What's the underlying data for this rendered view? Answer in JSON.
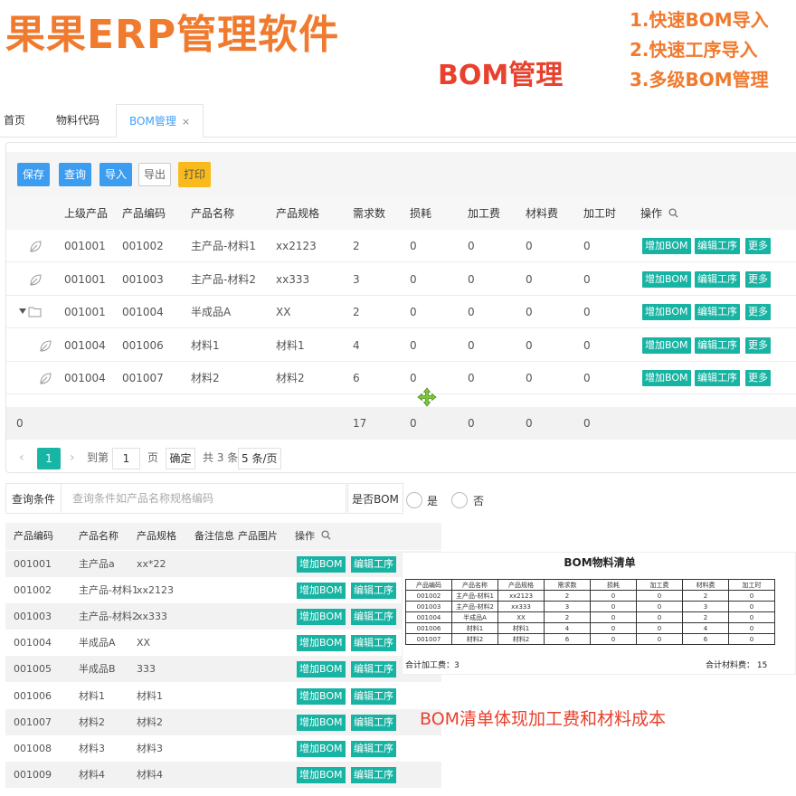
{
  "promo": {
    "title": "果果ERP管理软件",
    "subtitle": "BOM管理",
    "features": [
      "1.快速BOM导入",
      "2.快速工序导入",
      "3.多级BOM管理"
    ],
    "note": "BOM清单体现加工费和材料成本"
  },
  "tabs": [
    {
      "label": "首页"
    },
    {
      "label": "物料代码"
    },
    {
      "label": "BOM管理",
      "close": "×"
    }
  ],
  "toolbar": {
    "save": "保存",
    "query": "查询",
    "import": "导入",
    "export": "导出",
    "print": "打印"
  },
  "bom_table": {
    "headers": [
      "上级产品",
      "产品编码",
      "产品名称",
      "产品规格",
      "需求数",
      "损耗",
      "加工费",
      "材料费",
      "加工时",
      "操作"
    ],
    "rows": [
      {
        "parent": "001001",
        "code": "001002",
        "name": "主产品-材料1",
        "spec": "xx2123",
        "qty": "2",
        "loss": "0",
        "proc_fee": "0",
        "mat_fee": "0",
        "hours": "0",
        "icon": "leaf"
      },
      {
        "parent": "001001",
        "code": "001003",
        "name": "主产品-材料2",
        "spec": "xx333",
        "qty": "3",
        "loss": "0",
        "proc_fee": "0",
        "mat_fee": "0",
        "hours": "0",
        "icon": "leaf"
      },
      {
        "parent": "001001",
        "code": "001004",
        "name": "半成品A",
        "spec": "XX",
        "qty": "2",
        "loss": "0",
        "proc_fee": "0",
        "mat_fee": "0",
        "hours": "0",
        "icon": "folder"
      },
      {
        "parent": "001004",
        "code": "001006",
        "name": "材料1",
        "spec": "材料1",
        "qty": "4",
        "loss": "0",
        "proc_fee": "0",
        "mat_fee": "0",
        "hours": "0",
        "icon": "leaf"
      },
      {
        "parent": "001004",
        "code": "001007",
        "name": "材料2",
        "spec": "材料2",
        "qty": "6",
        "loss": "0",
        "proc_fee": "0",
        "mat_fee": "0",
        "hours": "0",
        "icon": "leaf"
      }
    ],
    "actions": [
      "增加BOM",
      "编辑工序",
      "更多"
    ],
    "footer": {
      "first": "0",
      "qty": "17",
      "loss": "0",
      "proc_fee": "0",
      "mat_fee": "0",
      "hours": "0"
    }
  },
  "pager": {
    "current": "1",
    "goto": "到第",
    "page_input": "1",
    "page_unit": "页",
    "confirm": "确定",
    "total": "共 3 条",
    "size": "5 条/页"
  },
  "search": {
    "label": "查询条件",
    "placeholder": "查询条件如产品名称规格编码",
    "isbom_label": "是否BOM",
    "yes": "是",
    "no": "否"
  },
  "product_table": {
    "headers": [
      "产品编码",
      "产品名称",
      "产品规格",
      "备注信息",
      "产品图片",
      "操作"
    ],
    "rows": [
      {
        "code": "001001",
        "name": "主产品a",
        "spec": "xx*22"
      },
      {
        "code": "001002",
        "name": "主产品-材料1",
        "spec": "xx2123"
      },
      {
        "code": "001003",
        "name": "主产品-材料2",
        "spec": "xx333"
      },
      {
        "code": "001004",
        "name": "半成品A",
        "spec": "XX"
      },
      {
        "code": "001005",
        "name": "半成品B",
        "spec": "333"
      },
      {
        "code": "001006",
        "name": "材料1",
        "spec": "材料1"
      },
      {
        "code": "001007",
        "name": "材料2",
        "spec": "材料2"
      },
      {
        "code": "001008",
        "name": "材料3",
        "spec": "材料3"
      },
      {
        "code": "001009",
        "name": "材料4",
        "spec": "材料4"
      }
    ],
    "actions": [
      "增加BOM",
      "编辑工序"
    ]
  },
  "report": {
    "title": "BOM物料清单",
    "headers": [
      "产品编码",
      "产品名称",
      "产品规格",
      "需求数",
      "损耗",
      "加工费",
      "材料费",
      "加工时"
    ],
    "rows": [
      [
        "001002",
        "主产品-材料1",
        "xx2123",
        "2",
        "0",
        "0",
        "2",
        "0"
      ],
      [
        "001003",
        "主产品-材料2",
        "xx333",
        "3",
        "0",
        "0",
        "3",
        "0"
      ],
      [
        "001004",
        "半成品A",
        "XX",
        "2",
        "0",
        "0",
        "2",
        "0"
      ],
      [
        "001006",
        "材料1",
        "材料1",
        "4",
        "0",
        "0",
        "4",
        "0"
      ],
      [
        "001007",
        "材料2",
        "材料2",
        "6",
        "0",
        "0",
        "6",
        "0"
      ]
    ],
    "total_proc": "合计加工费：3",
    "total_mat": "合计材料费： 15"
  },
  "colors": {
    "primary": "#3c9cf0",
    "teal": "#17b3a3",
    "orange": "#f07a2e",
    "red": "#e8412d",
    "yellow": "#f9ba1c"
  }
}
